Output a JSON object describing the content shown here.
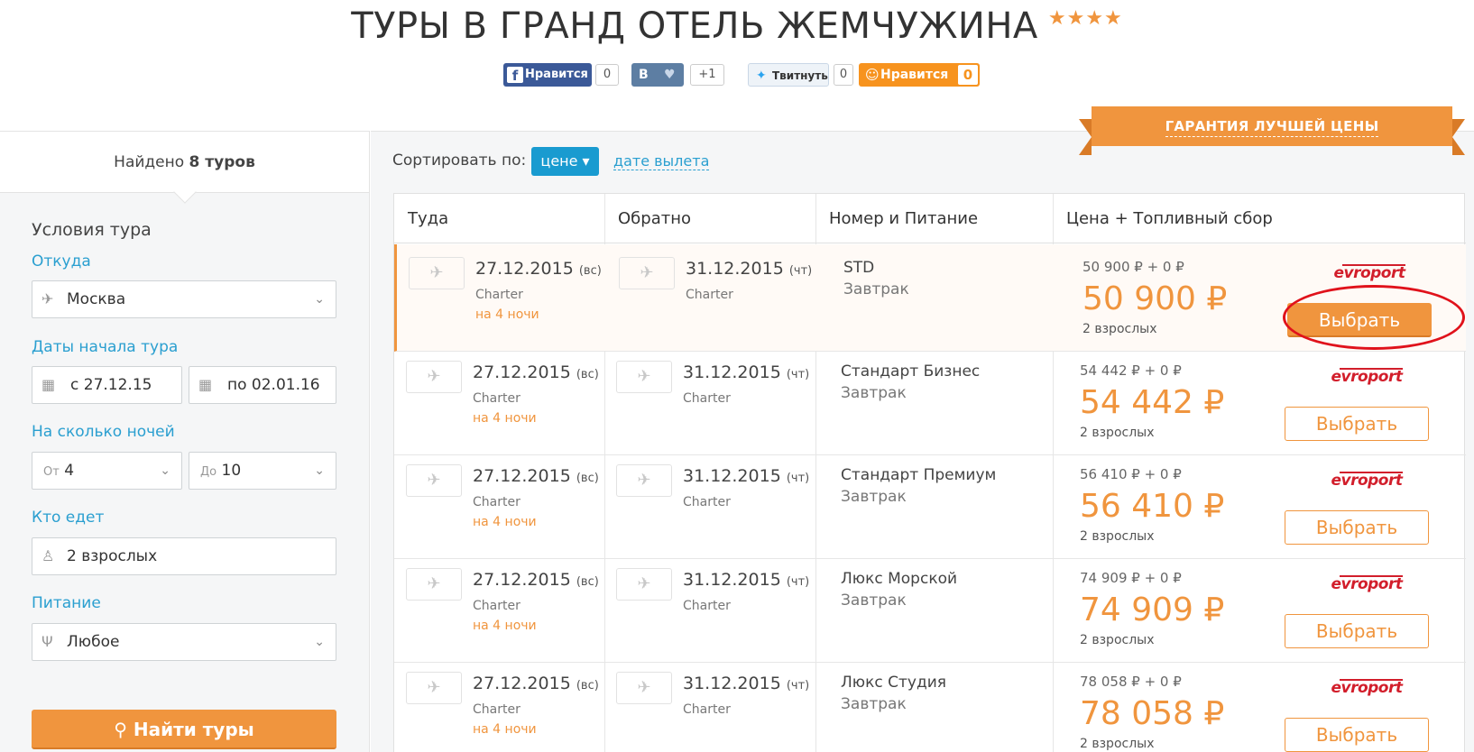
{
  "header": {
    "title": "ТУРЫ В ГРАНД ОТЕЛЬ ЖЕМЧУЖИНА",
    "stars": "★★★★"
  },
  "social": {
    "fb_label": "Нравится",
    "fb_count": "0",
    "vk_label": "В",
    "vk_count": "+1",
    "tw_label": "Твитнуть",
    "tw_count": "0",
    "ok_label": "Нравится",
    "ok_count": "0"
  },
  "guarantee": "ГАРАНТИЯ ЛУЧШЕЙ ЦЕНЫ",
  "sidebar": {
    "found_prefix": "Найдено",
    "found_count": "8 туров",
    "conditions_title": "Условия тура",
    "from_label": "Откуда",
    "from_value": "Москва",
    "dates_label": "Даты начала тура",
    "date_from_prefix": "с",
    "date_from": "27.12.15",
    "date_to_prefix": "по",
    "date_to": "02.01.16",
    "nights_label": "На сколько ночей",
    "nights_from_prefix": "От",
    "nights_from": "4",
    "nights_to_prefix": "До",
    "nights_to": "10",
    "who_label": "Кто едет",
    "who_value": "2 взрослых",
    "food_label": "Питание",
    "food_value": "Любое",
    "search_button": "Найти туры"
  },
  "sort": {
    "label": "Сортировать по:",
    "active": "цене ▾",
    "alt": "дате вылета"
  },
  "table": {
    "headers": [
      "Туда",
      "Обратно",
      "Номер и Питание",
      "Цена + Топливный сбор"
    ],
    "rows": [
      {
        "dep_date": "27.12.2015",
        "dep_dow": "(вс)",
        "dep_type": "Charter",
        "nights": "на 4 ночи",
        "ret_date": "31.12.2015",
        "ret_dow": "(чт)",
        "ret_type": "Charter",
        "room": "STD",
        "meal": "Завтрак",
        "price_detail": "50 900 ₽ + 0 ₽",
        "price": "50 900 ₽",
        "adults": "2 взрослых",
        "operator": "evroport",
        "button": "Выбрать"
      },
      {
        "dep_date": "27.12.2015",
        "dep_dow": "(вс)",
        "dep_type": "Charter",
        "nights": "на 4 ночи",
        "ret_date": "31.12.2015",
        "ret_dow": "(чт)",
        "ret_type": "Charter",
        "room": "Стандарт Бизнес",
        "meal": "Завтрак",
        "price_detail": "54 442 ₽ + 0 ₽",
        "price": "54 442 ₽",
        "adults": "2 взрослых",
        "operator": "evroport",
        "button": "Выбрать"
      },
      {
        "dep_date": "27.12.2015",
        "dep_dow": "(вс)",
        "dep_type": "Charter",
        "nights": "на 4 ночи",
        "ret_date": "31.12.2015",
        "ret_dow": "(чт)",
        "ret_type": "Charter",
        "room": "Стандарт Премиум",
        "meal": "Завтрак",
        "price_detail": "56 410 ₽ + 0 ₽",
        "price": "56 410 ₽",
        "adults": "2 взрослых",
        "operator": "evroport",
        "button": "Выбрать"
      },
      {
        "dep_date": "27.12.2015",
        "dep_dow": "(вс)",
        "dep_type": "Charter",
        "nights": "на 4 ночи",
        "ret_date": "31.12.2015",
        "ret_dow": "(чт)",
        "ret_type": "Charter",
        "room": "Люкс Морской",
        "meal": "Завтрак",
        "price_detail": "74 909 ₽ + 0 ₽",
        "price": "74 909 ₽",
        "adults": "2 взрослых",
        "operator": "evroport",
        "button": "Выбрать"
      },
      {
        "dep_date": "27.12.2015",
        "dep_dow": "(вс)",
        "dep_type": "Charter",
        "nights": "на 4 ночи",
        "ret_date": "31.12.2015",
        "ret_dow": "(чт)",
        "ret_type": "Charter",
        "room": "Люкс Студия",
        "meal": "Завтрак",
        "price_detail": "78 058 ₽ + 0 ₽",
        "price": "78 058 ₽",
        "adults": "2 взрослых",
        "operator": "evroport",
        "button": "Выбрать"
      }
    ]
  },
  "colors": {
    "accent": "#f0953e",
    "link": "#2a9fd0",
    "sort_active": "#199bd0",
    "highlight_oval": "#e0121b"
  }
}
